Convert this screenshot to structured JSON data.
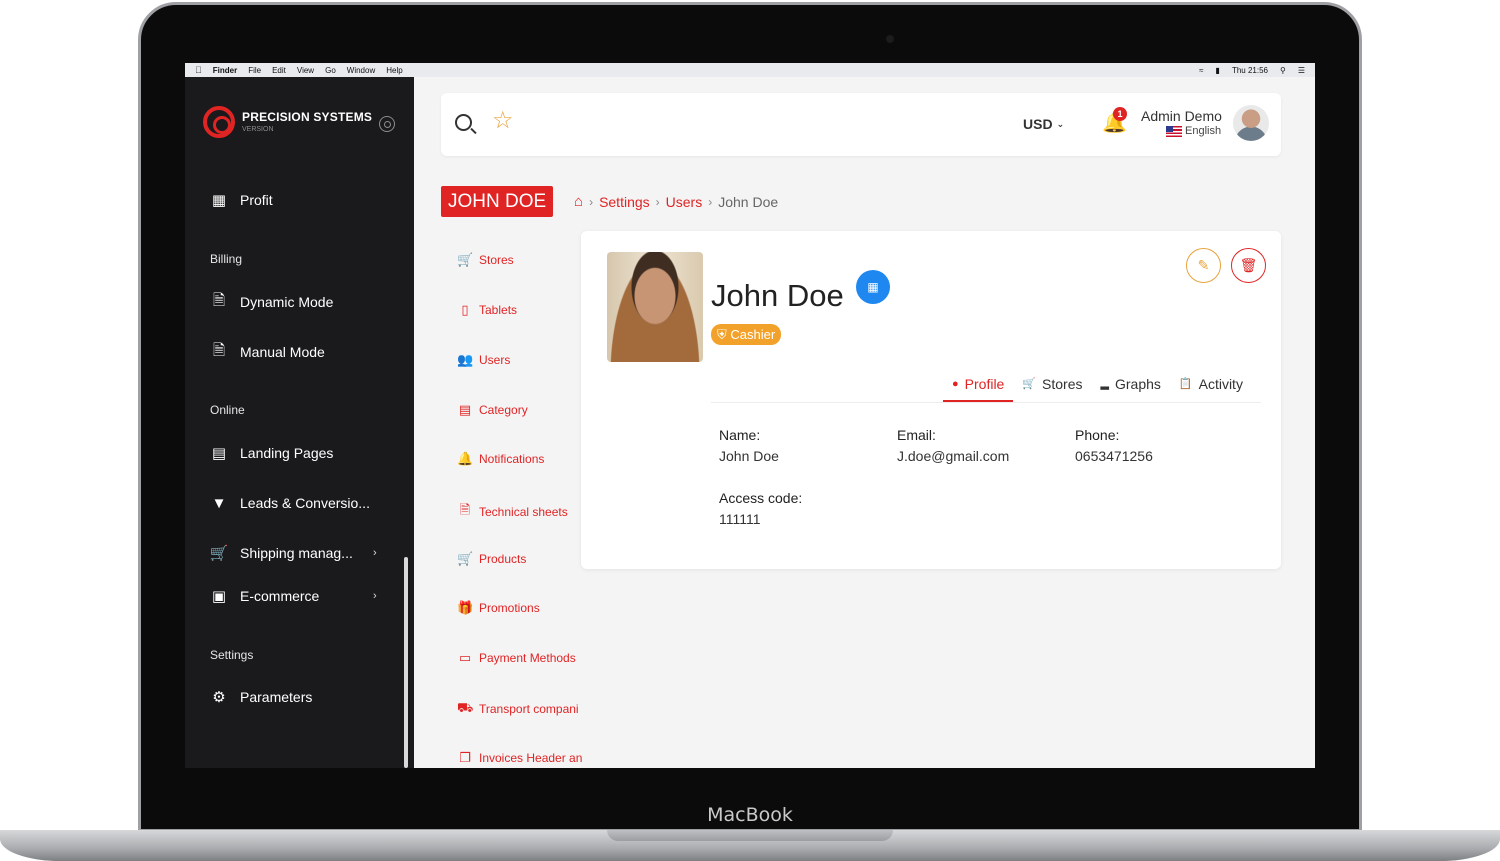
{
  "device": {
    "label": "MacBook"
  },
  "menubar": {
    "items": [
      "Finder",
      "File",
      "Edit",
      "View",
      "Go",
      "Window",
      "Help"
    ],
    "clock": "Thu 21:56"
  },
  "brand": {
    "name": "PRECISION SYSTEMS",
    "version": "VERSION"
  },
  "sidebar": {
    "items": [
      {
        "label": "Profit",
        "icon": "cash-icon"
      },
      {
        "label": "Dynamic Mode",
        "icon": "document-icon"
      },
      {
        "label": "Manual Mode",
        "icon": "document-icon"
      },
      {
        "label": "Landing Pages",
        "icon": "browser-icon"
      },
      {
        "label": "Leads & Conversio...",
        "icon": "funnel-icon"
      },
      {
        "label": "Shipping manag...",
        "icon": "cart-icon"
      },
      {
        "label": "E-commerce",
        "icon": "store-icon"
      },
      {
        "label": "Parameters",
        "icon": "gears-icon"
      }
    ],
    "sections": {
      "billing": "Billing",
      "online": "Online",
      "settings": "Settings"
    }
  },
  "topbar": {
    "currency": "USD",
    "notifications": "1",
    "user_name": "Admin Demo",
    "language": "English"
  },
  "page": {
    "badge": "JOHN DOE",
    "breadcrumb": [
      "Settings",
      "Users",
      "John Doe"
    ]
  },
  "subnav": [
    {
      "label": "Stores",
      "icon": "cart-icon"
    },
    {
      "label": "Tablets",
      "icon": "tablet-icon"
    },
    {
      "label": "Users",
      "icon": "users-icon"
    },
    {
      "label": "Category",
      "icon": "category-icon"
    },
    {
      "label": "Notifications",
      "icon": "bell-icon"
    },
    {
      "label": "Technical sheets",
      "icon": "sheet-icon"
    },
    {
      "label": "Products",
      "icon": "cart-icon"
    },
    {
      "label": "Promotions",
      "icon": "gift-icon"
    },
    {
      "label": "Payment Methods",
      "icon": "card-icon"
    },
    {
      "label": "Transport compani",
      "icon": "truck-icon"
    },
    {
      "label": "Invoices Header an",
      "icon": "copy-icon"
    }
  ],
  "profile": {
    "name": "John Doe",
    "role": "Cashier",
    "tabs": [
      "Profile",
      "Stores",
      "Graphs",
      "Activity"
    ],
    "fields": {
      "name_label": "Name:",
      "name_value": "John Doe",
      "email_label": "Email:",
      "email_value": "J.doe@gmail.com",
      "phone_label": "Phone:",
      "phone_value": "0653471256",
      "access_label": "Access code:",
      "access_value": "111111"
    }
  },
  "colors": {
    "accent": "#e02424",
    "warning": "#f2a12a",
    "info": "#1e88f0",
    "sidebar": "#1a1a1c"
  }
}
